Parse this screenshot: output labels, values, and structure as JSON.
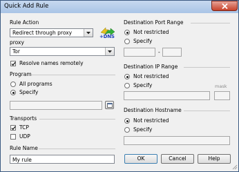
{
  "window": {
    "title": "Quick Add Rule"
  },
  "rule_action": {
    "label": "Rule Action",
    "selected": "Redirect through proxy",
    "icon_text": "+DNS"
  },
  "proxy": {
    "label": "proxy",
    "selected": "Tor"
  },
  "resolve_remotely": {
    "label": "Resolve names remotely",
    "checked": true
  },
  "program": {
    "label": "Program",
    "options": [
      "All programs",
      "Specify"
    ],
    "selected": "Specify",
    "path": ""
  },
  "transports": {
    "label": "Transports",
    "items": [
      {
        "label": "TCP",
        "checked": true
      },
      {
        "label": "UDP",
        "checked": false
      }
    ]
  },
  "rule_name": {
    "label": "Rule Name",
    "value": "My rule"
  },
  "destination_port": {
    "label": "Destination Port Range",
    "options": [
      "Not restricted",
      "Specify"
    ],
    "selected": "Not restricted",
    "separator": "-"
  },
  "destination_ip": {
    "label": "Destination IP Range",
    "options": [
      "Not restricted",
      "Specify"
    ],
    "selected": "Not restricted",
    "mask_label": "mask"
  },
  "destination_hostname": {
    "label": "Destination Hostname",
    "options": [
      "Not restricted",
      "Specify"
    ],
    "selected": "Not restricted"
  },
  "buttons": {
    "ok": "OK",
    "cancel": "Cancel",
    "help": "Help"
  },
  "colors": {
    "titlebar": "#b7cde9",
    "close": "#c7432c",
    "dns_text": "#1c3dbb"
  }
}
